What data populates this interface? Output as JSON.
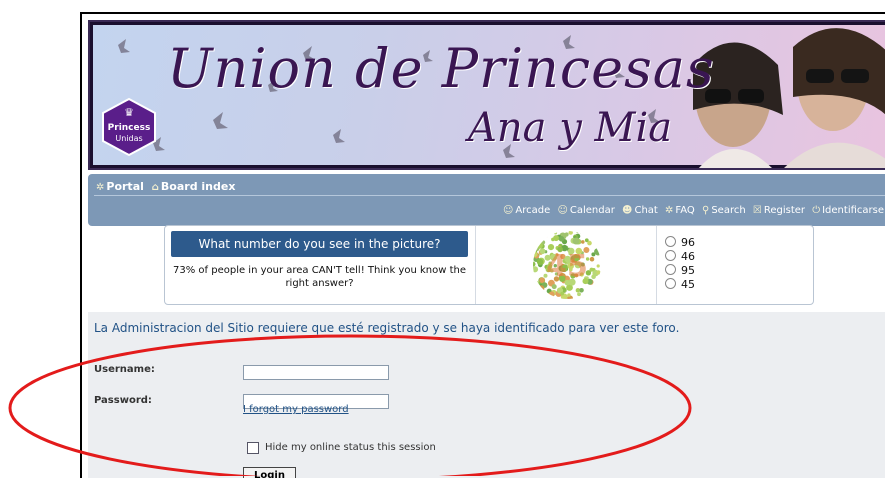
{
  "banner": {
    "title_line1": "Union de Princesas",
    "title_line2": "Ana y Mia",
    "badge_line1": "Princess",
    "badge_line2": "Unidas"
  },
  "nav": {
    "portal": "Portal",
    "board_index": "Board index",
    "links": {
      "arcade": "Arcade",
      "calendar": "Calendar",
      "chat": "Chat",
      "faq": "FAQ",
      "search": "Search",
      "register": "Register",
      "identificarse": "Identificarse"
    }
  },
  "ad": {
    "question": "What number do you see in the picture?",
    "subtext": "73% of people in your area CAN'T tell! Think you know the right answer?",
    "hidden_number": "45",
    "options": [
      "96",
      "46",
      "95",
      "45"
    ]
  },
  "login": {
    "message": "La Administracion del Sitio requiere que esté registrado y se haya identificado para ver este foro.",
    "username_label": "Username:",
    "password_label": "Password:",
    "forgot": "I forgot my password",
    "hide_status": "Hide my online status this session",
    "login_button": "Login"
  },
  "colors": {
    "navbar": "#7d98b6",
    "ad_question_bg": "#2d5a8c",
    "link": "#215286",
    "annotation_ellipse": "#e31b1b"
  }
}
